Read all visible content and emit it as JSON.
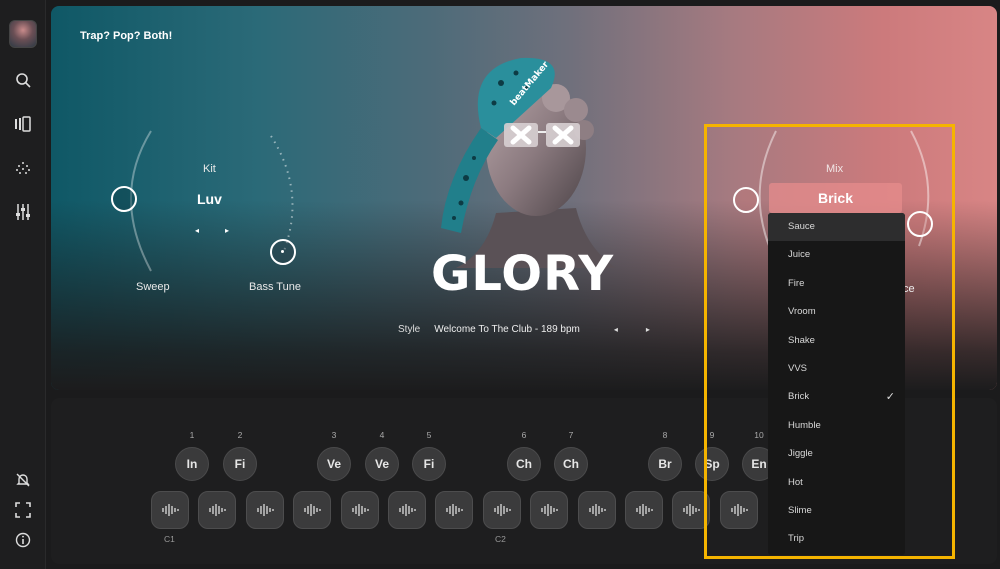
{
  "sidebar": {
    "icons": [
      "search-icon",
      "library-icon",
      "dots-grid-icon",
      "sliders-icon",
      "notifications-off-icon",
      "fullscreen-icon",
      "info-icon"
    ]
  },
  "hero": {
    "tagline": "Trap? Pop? Both!",
    "title": "GLORY",
    "kit": {
      "label": "Kit",
      "value": "Luv"
    },
    "sweep_label": "Sweep",
    "bass_tune_label": "Bass Tune",
    "style": {
      "label": "Style",
      "value": "Welcome To The Club - 189 bpm"
    },
    "mix": {
      "label": "Mix",
      "value": "Brick"
    },
    "partial_label": "ce",
    "hat_text": "beatMaker"
  },
  "mix_dropdown": {
    "options": [
      "Sauce",
      "Juice",
      "Fire",
      "Vroom",
      "Shake",
      "VVS",
      "Brick",
      "Humble",
      "Jiggle",
      "Hot",
      "Slime",
      "Trip"
    ],
    "selected": "Brick",
    "hovered": "Sauce"
  },
  "pads": {
    "numbers": [
      "1",
      "2",
      "3",
      "4",
      "5",
      "6",
      "7",
      "8",
      "9",
      "10"
    ],
    "labels": [
      "In",
      "Fi",
      "Ve",
      "Ve",
      "Fi",
      "Ch",
      "Ch",
      "Br",
      "Sp",
      "En"
    ],
    "row_labels": [
      "C1",
      "C2"
    ]
  },
  "colors": {
    "highlight_box": "#f5b400",
    "hero_left": "#0f5866",
    "hero_right": "#d88585"
  }
}
